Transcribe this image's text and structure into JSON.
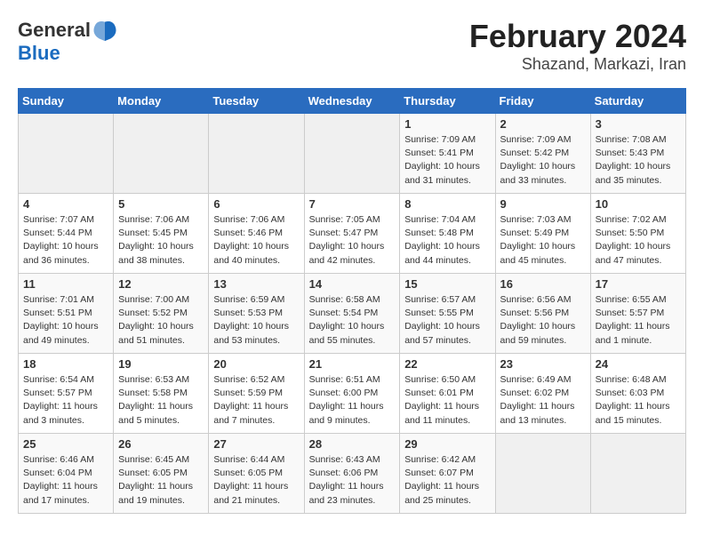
{
  "header": {
    "logo_general": "General",
    "logo_blue": "Blue",
    "title": "February 2024",
    "location": "Shazand, Markazi, Iran"
  },
  "days_of_week": [
    "Sunday",
    "Monday",
    "Tuesday",
    "Wednesday",
    "Thursday",
    "Friday",
    "Saturday"
  ],
  "weeks": [
    [
      {
        "day": "",
        "detail": ""
      },
      {
        "day": "",
        "detail": ""
      },
      {
        "day": "",
        "detail": ""
      },
      {
        "day": "",
        "detail": ""
      },
      {
        "day": "1",
        "detail": "Sunrise: 7:09 AM\nSunset: 5:41 PM\nDaylight: 10 hours\nand 31 minutes."
      },
      {
        "day": "2",
        "detail": "Sunrise: 7:09 AM\nSunset: 5:42 PM\nDaylight: 10 hours\nand 33 minutes."
      },
      {
        "day": "3",
        "detail": "Sunrise: 7:08 AM\nSunset: 5:43 PM\nDaylight: 10 hours\nand 35 minutes."
      }
    ],
    [
      {
        "day": "4",
        "detail": "Sunrise: 7:07 AM\nSunset: 5:44 PM\nDaylight: 10 hours\nand 36 minutes."
      },
      {
        "day": "5",
        "detail": "Sunrise: 7:06 AM\nSunset: 5:45 PM\nDaylight: 10 hours\nand 38 minutes."
      },
      {
        "day": "6",
        "detail": "Sunrise: 7:06 AM\nSunset: 5:46 PM\nDaylight: 10 hours\nand 40 minutes."
      },
      {
        "day": "7",
        "detail": "Sunrise: 7:05 AM\nSunset: 5:47 PM\nDaylight: 10 hours\nand 42 minutes."
      },
      {
        "day": "8",
        "detail": "Sunrise: 7:04 AM\nSunset: 5:48 PM\nDaylight: 10 hours\nand 44 minutes."
      },
      {
        "day": "9",
        "detail": "Sunrise: 7:03 AM\nSunset: 5:49 PM\nDaylight: 10 hours\nand 45 minutes."
      },
      {
        "day": "10",
        "detail": "Sunrise: 7:02 AM\nSunset: 5:50 PM\nDaylight: 10 hours\nand 47 minutes."
      }
    ],
    [
      {
        "day": "11",
        "detail": "Sunrise: 7:01 AM\nSunset: 5:51 PM\nDaylight: 10 hours\nand 49 minutes."
      },
      {
        "day": "12",
        "detail": "Sunrise: 7:00 AM\nSunset: 5:52 PM\nDaylight: 10 hours\nand 51 minutes."
      },
      {
        "day": "13",
        "detail": "Sunrise: 6:59 AM\nSunset: 5:53 PM\nDaylight: 10 hours\nand 53 minutes."
      },
      {
        "day": "14",
        "detail": "Sunrise: 6:58 AM\nSunset: 5:54 PM\nDaylight: 10 hours\nand 55 minutes."
      },
      {
        "day": "15",
        "detail": "Sunrise: 6:57 AM\nSunset: 5:55 PM\nDaylight: 10 hours\nand 57 minutes."
      },
      {
        "day": "16",
        "detail": "Sunrise: 6:56 AM\nSunset: 5:56 PM\nDaylight: 10 hours\nand 59 minutes."
      },
      {
        "day": "17",
        "detail": "Sunrise: 6:55 AM\nSunset: 5:57 PM\nDaylight: 11 hours\nand 1 minute."
      }
    ],
    [
      {
        "day": "18",
        "detail": "Sunrise: 6:54 AM\nSunset: 5:57 PM\nDaylight: 11 hours\nand 3 minutes."
      },
      {
        "day": "19",
        "detail": "Sunrise: 6:53 AM\nSunset: 5:58 PM\nDaylight: 11 hours\nand 5 minutes."
      },
      {
        "day": "20",
        "detail": "Sunrise: 6:52 AM\nSunset: 5:59 PM\nDaylight: 11 hours\nand 7 minutes."
      },
      {
        "day": "21",
        "detail": "Sunrise: 6:51 AM\nSunset: 6:00 PM\nDaylight: 11 hours\nand 9 minutes."
      },
      {
        "day": "22",
        "detail": "Sunrise: 6:50 AM\nSunset: 6:01 PM\nDaylight: 11 hours\nand 11 minutes."
      },
      {
        "day": "23",
        "detail": "Sunrise: 6:49 AM\nSunset: 6:02 PM\nDaylight: 11 hours\nand 13 minutes."
      },
      {
        "day": "24",
        "detail": "Sunrise: 6:48 AM\nSunset: 6:03 PM\nDaylight: 11 hours\nand 15 minutes."
      }
    ],
    [
      {
        "day": "25",
        "detail": "Sunrise: 6:46 AM\nSunset: 6:04 PM\nDaylight: 11 hours\nand 17 minutes."
      },
      {
        "day": "26",
        "detail": "Sunrise: 6:45 AM\nSunset: 6:05 PM\nDaylight: 11 hours\nand 19 minutes."
      },
      {
        "day": "27",
        "detail": "Sunrise: 6:44 AM\nSunset: 6:05 PM\nDaylight: 11 hours\nand 21 minutes."
      },
      {
        "day": "28",
        "detail": "Sunrise: 6:43 AM\nSunset: 6:06 PM\nDaylight: 11 hours\nand 23 minutes."
      },
      {
        "day": "29",
        "detail": "Sunrise: 6:42 AM\nSunset: 6:07 PM\nDaylight: 11 hours\nand 25 minutes."
      },
      {
        "day": "",
        "detail": ""
      },
      {
        "day": "",
        "detail": ""
      }
    ]
  ]
}
